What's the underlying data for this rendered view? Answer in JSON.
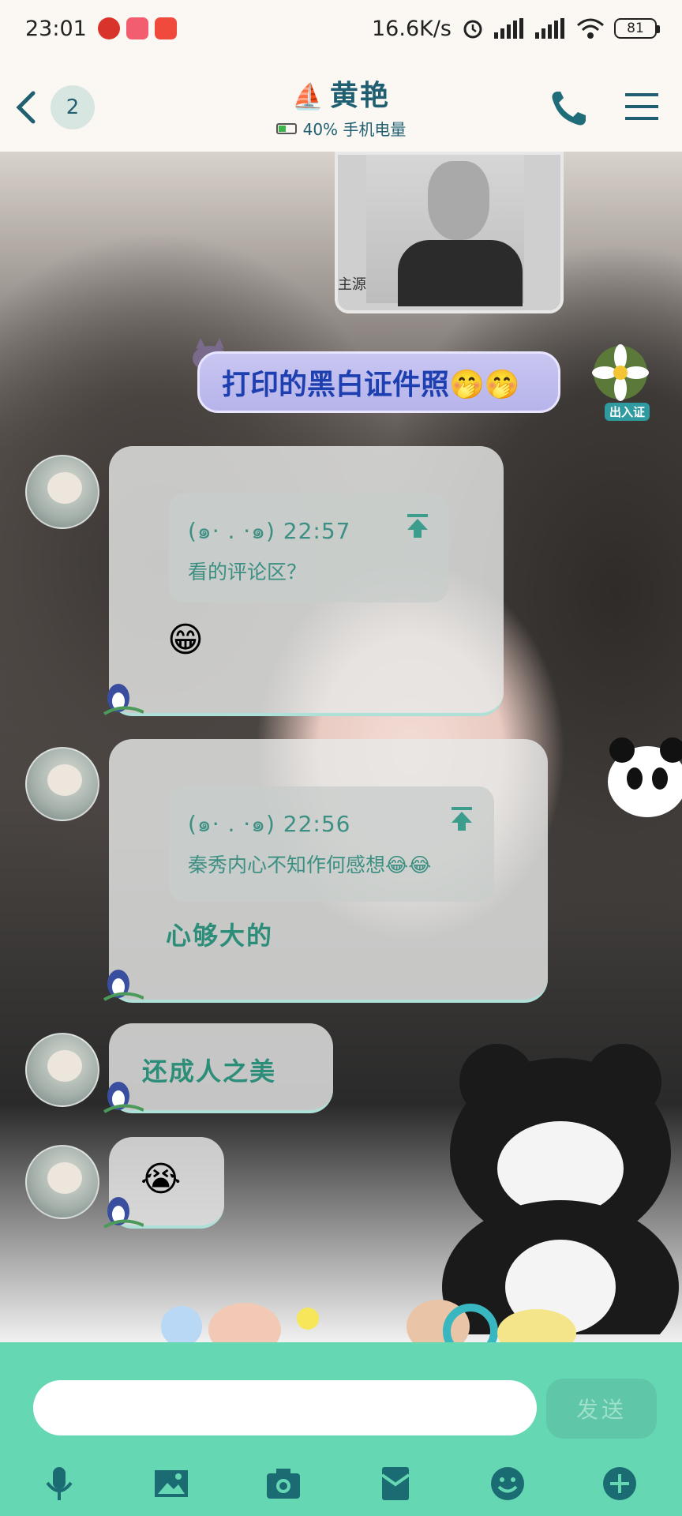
{
  "status_bar": {
    "time": "23:01",
    "network_speed": "16.6K/s",
    "battery": "81"
  },
  "header": {
    "badge_count": "2",
    "title": "黄艳",
    "battery_text": "40% 手机电量"
  },
  "messages": {
    "photo_caption": "主源",
    "sent_text": "打印的黑白证件照🤭🤭",
    "sent_sticker": "出入证",
    "msg1": {
      "quote_time": "(๑· . ·๑) 22:57",
      "quote_text": "看的评论区？",
      "emoji": "😁"
    },
    "msg2": {
      "quote_time": "(๑· . ·๑) 22:56",
      "quote_text": "秦秀内心不知作何感想😂😂",
      "text": "心够大的"
    },
    "msg3": {
      "text": "还成人之美"
    },
    "msg4": {
      "emoji": "😭"
    }
  },
  "composer": {
    "placeholder": "",
    "send_label": "发送"
  },
  "colors": {
    "accent": "#1f5f71",
    "bottom_bar": "#66d7b3",
    "message_text": "#2c8d79"
  },
  "icons": [
    "back-icon",
    "phone-icon",
    "menu-icon",
    "mic-icon",
    "image-icon",
    "camera-icon",
    "red-packet-icon",
    "emoji-icon",
    "plus-icon"
  ]
}
